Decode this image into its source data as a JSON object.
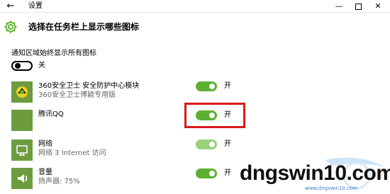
{
  "window": {
    "title": "设置",
    "back_glyph": "←",
    "min_glyph": "—",
    "close_glyph": "✕"
  },
  "header": {
    "title": "选择在任务栏上显示哪些图标",
    "icon": "gear-icon",
    "icon_color": "#5cb030"
  },
  "always_show": {
    "label": "通知区域始终显示所有图标",
    "state_label": "关",
    "on": false
  },
  "apps": [
    {
      "name": "360安全卫士 安全防护中心模块",
      "subtitle": "360安全卫士博颖专用版",
      "state_label": "开",
      "on": true,
      "icon": "360-safeguard-icon"
    },
    {
      "name": "腾讯QQ",
      "subtitle": "",
      "state_label": "开",
      "on": true,
      "icon": "qq-icon"
    },
    {
      "name": "网络",
      "subtitle": "网络  3 Internet 访问",
      "state_label": "开",
      "on": true,
      "icon": "network-icon"
    },
    {
      "name": "音量",
      "subtitle": "扬声器: 75%",
      "state_label": "开",
      "on": true,
      "icon": "volume-icon"
    }
  ],
  "colors": {
    "toggle_on": "#5cb030",
    "app_tile": "#6d9c3f",
    "highlight": "#d91a1a"
  },
  "watermark": {
    "text": "dngswin10.com",
    "subtext": "www.dngswin10.com"
  }
}
